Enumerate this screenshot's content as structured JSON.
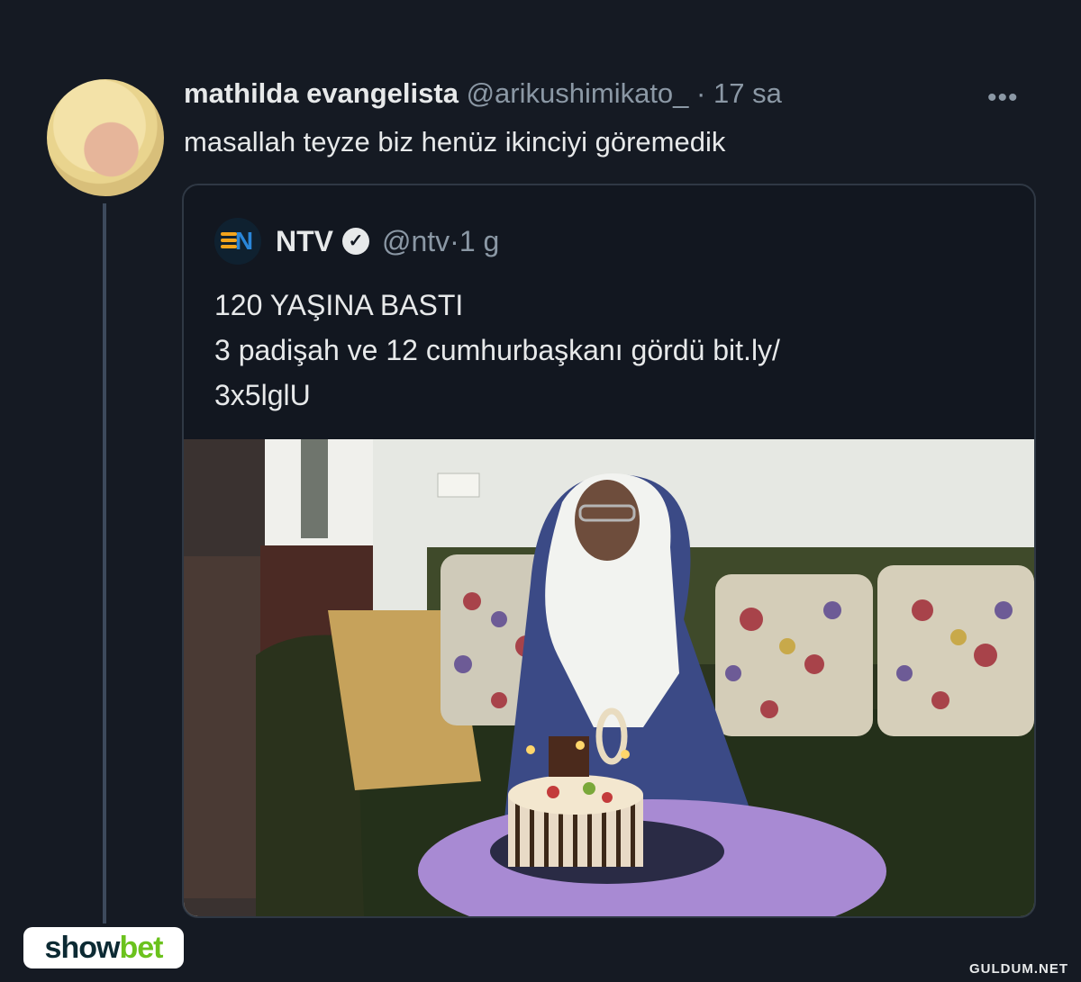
{
  "tweet": {
    "author_name": "mathilda evangelista",
    "handle": "@arikushimikato_",
    "separator": "·",
    "time": "17 sa",
    "text": "masallah teyze biz henüz ikinciyi göremedik",
    "more_label": "•••"
  },
  "quote": {
    "author_name": "NTV",
    "logo_letter": "N",
    "handle": "@ntv",
    "separator": "·",
    "time": "1 g",
    "lines": [
      "120 YAŞINA BASTI",
      "3 padişah ve 12 cumhurbaşkanı gördü bit.ly/",
      "3x5lglU"
    ]
  },
  "branding": {
    "badge_part1": "show",
    "badge_part2": "bet",
    "watermark": "GULDUM.NET"
  },
  "colors": {
    "background": "#151a23",
    "muted_text": "#8b98a5",
    "badge_green": "#6bc21d",
    "ntv_orange": "#f2a41c",
    "ntv_blue": "#2a86d8"
  }
}
